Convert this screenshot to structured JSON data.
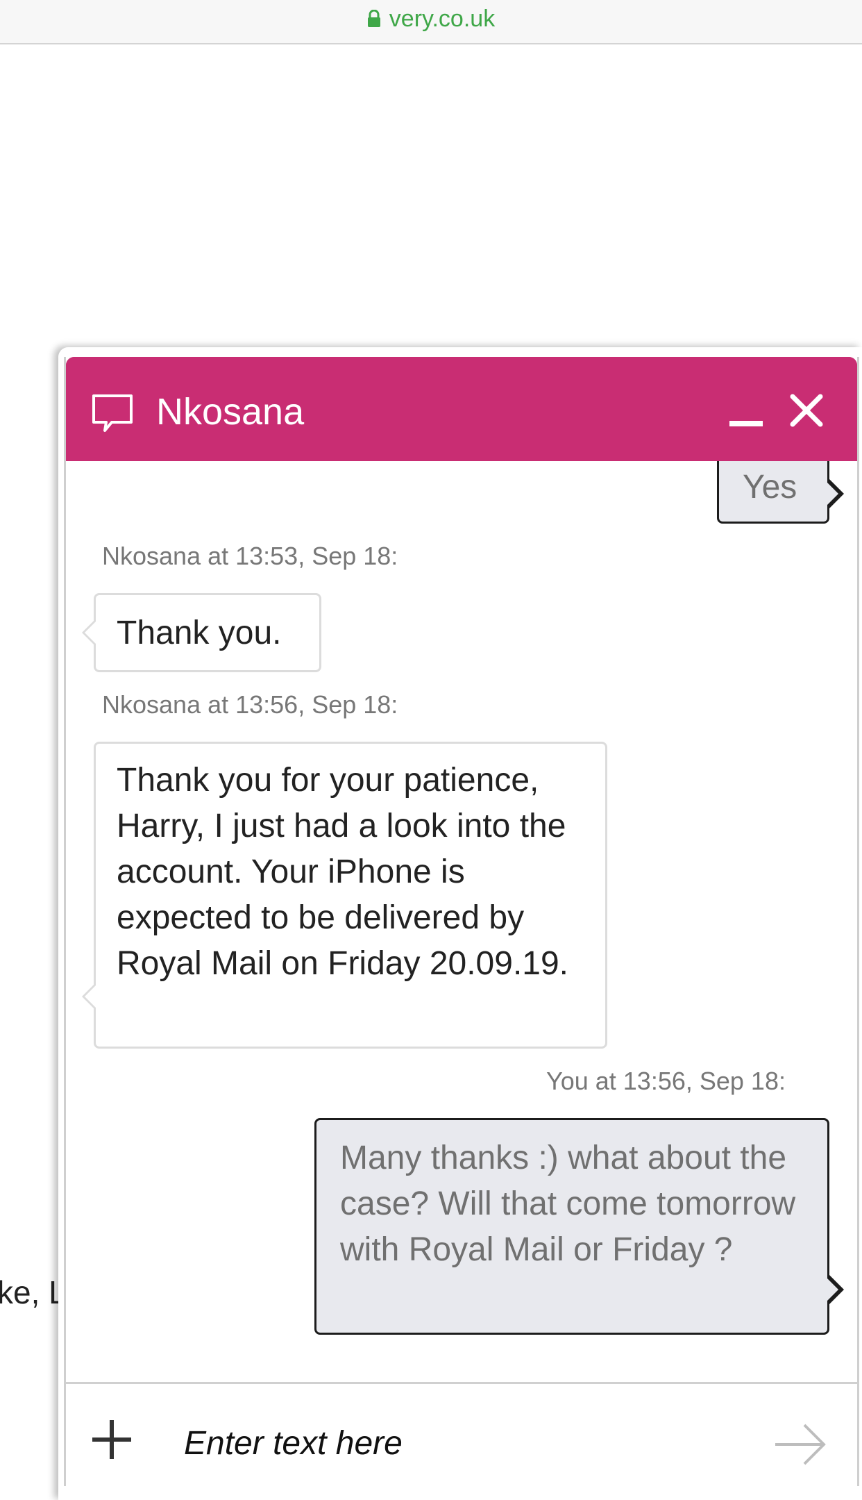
{
  "browser": {
    "url": "very.co.uk"
  },
  "background": {
    "fragment_text": "ke, Li"
  },
  "chat": {
    "agent_name": "Nkosana",
    "messages": [
      {
        "sender": "you",
        "text": "Yes"
      },
      {
        "sender": "agent",
        "meta": "Nkosana at 13:53, Sep 18:",
        "text": "Thank you."
      },
      {
        "sender": "agent",
        "meta": "Nkosana at 13:56, Sep 18:",
        "text": "Thank you for your patience, Harry, I just had a look into the account. Your iPhone is expected to be delivered by Royal Mail on Friday 20.09.19."
      },
      {
        "sender": "you",
        "meta": "You at 13:56, Sep 18:",
        "text": "Many thanks :) what about the case? Will that come tomorrow with Royal Mail or Friday ?"
      }
    ],
    "input": {
      "placeholder": "Enter text here",
      "value": ""
    }
  },
  "colors": {
    "header": "#c92d73",
    "url_text": "#3fa748",
    "user_bubble": "#e8e9ee"
  },
  "icons": [
    "lock-icon",
    "chat-bubble-icon",
    "minimize-icon",
    "close-icon",
    "plus-icon",
    "send-arrow-icon"
  ]
}
